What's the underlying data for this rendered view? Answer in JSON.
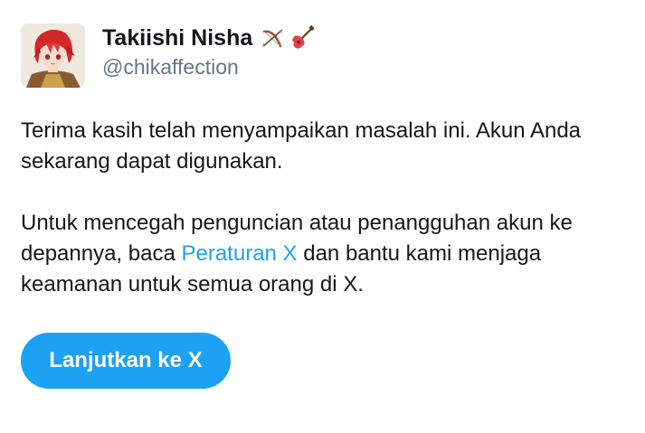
{
  "user": {
    "display_name": "Takiishi Nisha",
    "handle": "@chikaffection",
    "name_emojis": [
      "bow-and-arrow-icon",
      "guitar-icon"
    ]
  },
  "message": {
    "paragraph1": "Terima kasih telah menyampaikan masalah ini. Akun Anda sekarang dapat digunakan.",
    "paragraph2_before": "Untuk mencegah penguncian atau penangguhan akun ke depannya, baca ",
    "paragraph2_link": "Peraturan X",
    "paragraph2_after": " dan bantu kami menjaga keamanan untuk semua orang di X."
  },
  "cta": {
    "label": "Lanjutkan ke X"
  },
  "colors": {
    "accent": "#1da1f2",
    "text": "#14171a",
    "secondary": "#657786"
  }
}
